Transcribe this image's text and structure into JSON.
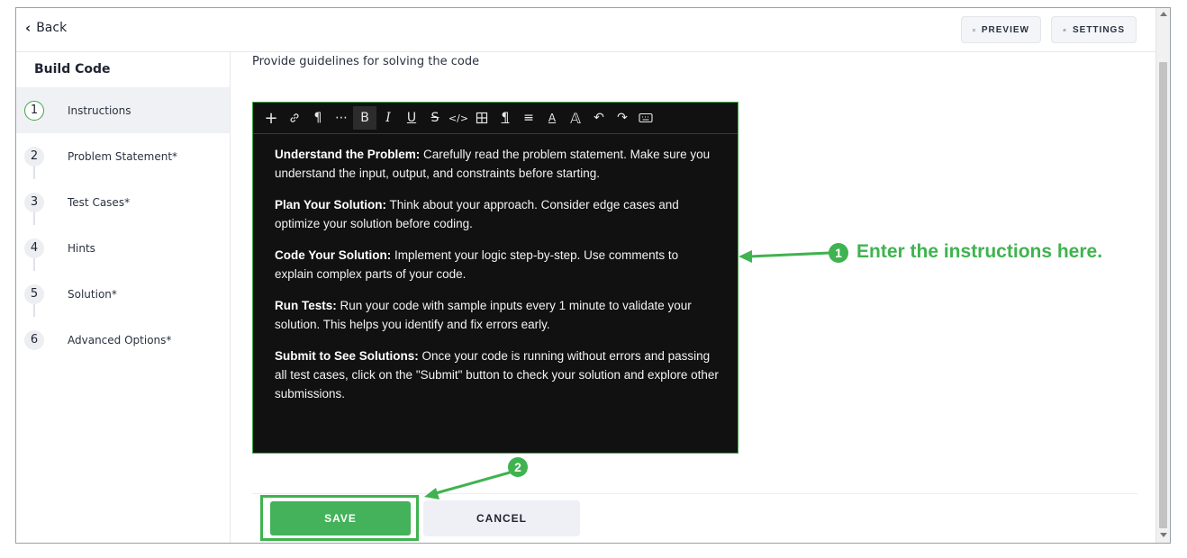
{
  "header": {
    "back_label": "Back",
    "preview_label": "PREVIEW",
    "settings_label": "SETTINGS"
  },
  "sidebar": {
    "title": "Build Code",
    "steps": [
      {
        "num": "1",
        "label": "Instructions"
      },
      {
        "num": "2",
        "label": "Problem Statement*"
      },
      {
        "num": "3",
        "label": "Test Cases*"
      },
      {
        "num": "4",
        "label": "Hints"
      },
      {
        "num": "5",
        "label": "Solution*"
      },
      {
        "num": "6",
        "label": "Advanced Options*"
      }
    ]
  },
  "main": {
    "guide_text": "Provide guidelines for solving the code",
    "toolbar_icons": [
      "plus-icon",
      "link-icon",
      "paragraph-icon",
      "more-icon",
      "bold-icon",
      "italic-icon",
      "underline-icon",
      "strikethrough-icon",
      "code-icon",
      "table-icon",
      "paragraph-format-icon",
      "align-icon",
      "font-color-icon",
      "font-size-icon",
      "undo-icon",
      "redo-icon",
      "keyboard-icon"
    ],
    "paragraphs": [
      {
        "title": "Understand the Problem:",
        "text": " Carefully read the problem statement. Make sure you understand the input, output, and constraints before starting."
      },
      {
        "title": "Plan Your Solution:",
        "text": " Think about your approach. Consider edge cases and optimize your solution before coding."
      },
      {
        "title": "Code Your Solution:",
        "text": " Implement your logic step-by-step. Use comments to explain complex parts of your code."
      },
      {
        "title": "Run Tests:",
        "text": " Run your code with sample inputs every 1 minute to validate your solution. This helps you identify and fix errors early."
      },
      {
        "title": "Submit to See Solutions:",
        "text": " Once your code is running without errors and passing all test cases, click on the \"Submit\" button to check your solution and explore other submissions."
      }
    ],
    "save_label": "SAVE",
    "cancel_label": "CANCEL"
  },
  "annotations": {
    "callout1_num": "1",
    "callout1_text": "Enter the instructions here.",
    "callout2_num": "2",
    "color": "#3fb34f"
  },
  "colors": {
    "accent": "#44b25a",
    "editor_bg": "#111111"
  }
}
